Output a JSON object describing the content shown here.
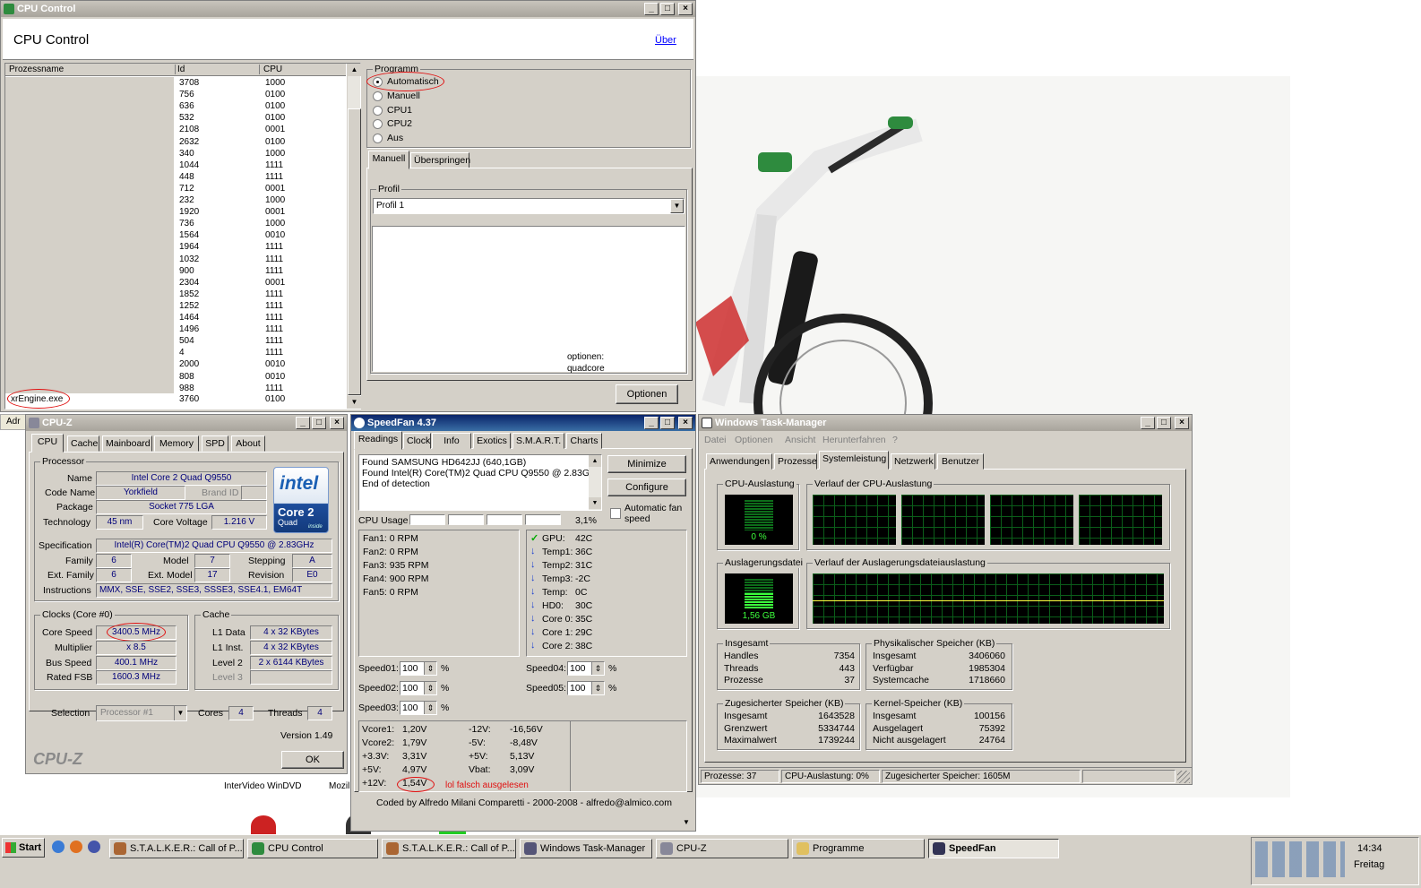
{
  "cpu_control": {
    "title": "CPU Control",
    "heading": "CPU Control",
    "about_link": "Über",
    "columns": [
      "Prozessname",
      "Id",
      "CPU"
    ],
    "rows": [
      {
        "id": "3708",
        "cpu": "1000"
      },
      {
        "id": "756",
        "cpu": "0100"
      },
      {
        "id": "636",
        "cpu": "0100"
      },
      {
        "id": "532",
        "cpu": "0100"
      },
      {
        "id": "2108",
        "cpu": "0001"
      },
      {
        "id": "2632",
        "cpu": "0100"
      },
      {
        "id": "340",
        "cpu": "1000"
      },
      {
        "id": "1044",
        "cpu": "1111"
      },
      {
        "id": "448",
        "cpu": "1111"
      },
      {
        "id": "712",
        "cpu": "0001"
      },
      {
        "id": "232",
        "cpu": "1000"
      },
      {
        "id": "1920",
        "cpu": "0001"
      },
      {
        "id": "736",
        "cpu": "1000"
      },
      {
        "id": "1564",
        "cpu": "0010"
      },
      {
        "id": "1964",
        "cpu": "1111"
      },
      {
        "id": "1032",
        "cpu": "1111"
      },
      {
        "id": "900",
        "cpu": "1111"
      },
      {
        "id": "2304",
        "cpu": "0001"
      },
      {
        "id": "1852",
        "cpu": "1111"
      },
      {
        "id": "1252",
        "cpu": "1111"
      },
      {
        "id": "1464",
        "cpu": "1111"
      },
      {
        "id": "1496",
        "cpu": "1111"
      },
      {
        "id": "504",
        "cpu": "1111"
      },
      {
        "id": "4",
        "cpu": "1111"
      },
      {
        "id": "2000",
        "cpu": "0010"
      },
      {
        "id": "808",
        "cpu": "0010"
      },
      {
        "id": "988",
        "cpu": "1111"
      }
    ],
    "selected_row": {
      "name": "xrEngine.exe",
      "id": "3760",
      "cpu": "0100"
    },
    "program_group": "Programm",
    "program_options": [
      "Automatisch",
      "Manuell",
      "CPU1",
      "CPU2",
      "Aus"
    ],
    "program_selected": "Automatisch",
    "tabs": [
      "Manuell",
      "Überspringen"
    ],
    "profile_group": "Profil",
    "profile_value": "Profil 1",
    "options_note_1": "optionen:",
    "options_note_2": "quadcore",
    "options_button": "Optionen"
  },
  "cpuz": {
    "title": "CPU-Z",
    "tabs": [
      "CPU",
      "Cache",
      "Mainboard",
      "Memory",
      "SPD",
      "About"
    ],
    "processor_group": "Processor",
    "name_label": "Name",
    "name": "Intel Core 2 Quad Q9550",
    "codename_label": "Code Name",
    "codename": "Yorkfield",
    "brandid_label": "Brand ID",
    "package_label": "Package",
    "package": "Socket 775 LGA",
    "technology_label": "Technology",
    "technology": "45 nm",
    "voltage_label": "Core Voltage",
    "voltage": "1.216 V",
    "spec_label": "Specification",
    "spec": "Intel(R) Core(TM)2 Quad CPU   Q9550  @ 2.83GHz",
    "family_label": "Family",
    "family": "6",
    "model_label": "Model",
    "model": "7",
    "stepping_label": "Stepping",
    "stepping": "A",
    "extfamily_label": "Ext. Family",
    "extfamily": "6",
    "extmodel_label": "Ext. Model",
    "extmodel": "17",
    "revision_label": "Revision",
    "revision": "E0",
    "instructions_label": "Instructions",
    "instructions": "MMX, SSE, SSE2, SSE3, SSSE3, SSE4.1, EM64T",
    "clocks_group": "Clocks (Core #0)",
    "corespeed_label": "Core Speed",
    "corespeed": "3400.5 MHz",
    "multiplier_label": "Multiplier",
    "multiplier": "x 8.5",
    "busspeed_label": "Bus Speed",
    "busspeed": "400.1 MHz",
    "ratedfsb_label": "Rated FSB",
    "ratedfsb": "1600.3 MHz",
    "cache_group": "Cache",
    "l1d_label": "L1 Data",
    "l1d": "4 x 32 KBytes",
    "l1i_label": "L1 Inst.",
    "l1i": "4 x 32 KBytes",
    "l2_label": "Level 2",
    "l2": "2 x 6144 KBytes",
    "l3_label": "Level 3",
    "selection_label": "Selection",
    "selection": "Processor #1",
    "cores_label": "Cores",
    "cores": "4",
    "threads_label": "Threads",
    "threads": "4",
    "version": "Version 1.49",
    "brand_footer": "CPU-Z",
    "ok_button": "OK",
    "intel_logo": "intel",
    "intel_product": "Core 2",
    "intel_quad": "Quad",
    "intel_inside": "inside"
  },
  "speedfan": {
    "title": "SpeedFan 4.37",
    "tabs": [
      "Readings",
      "Clock",
      "Info",
      "Exotics",
      "S.M.A.R.T.",
      "Charts"
    ],
    "log": [
      "Found SAMSUNG HD642JJ (640,1GB)",
      "Found Intel(R) Core(TM)2 Quad CPU Q9550 @ 2.83GHz",
      "End of detection"
    ],
    "minimize_button": "Minimize",
    "configure_button": "Configure",
    "auto_fan_label": "Automatic fan speed",
    "cpu_usage_label": "CPU Usage",
    "cpu_usage_value": "3,1%",
    "fans": [
      "Fan1: 0 RPM",
      "Fan2: 0 RPM",
      "Fan3: 935 RPM",
      "Fan4: 900 RPM",
      "Fan5: 0 RPM"
    ],
    "temps": [
      {
        "label": "GPU:",
        "value": "42C",
        "status": "ok"
      },
      {
        "label": "Temp1:",
        "value": "36C",
        "status": "down"
      },
      {
        "label": "Temp2:",
        "value": "31C",
        "status": "down"
      },
      {
        "label": "Temp3:",
        "value": "-2C",
        "status": "down"
      },
      {
        "label": "Temp:",
        "value": "0C",
        "status": "down"
      },
      {
        "label": "HD0:",
        "value": "30C",
        "status": "down"
      },
      {
        "label": "Core 0:",
        "value": "35C",
        "status": "down"
      },
      {
        "label": "Core 1:",
        "value": "29C",
        "status": "down"
      },
      {
        "label": "Core 2:",
        "value": "38C",
        "status": "down"
      }
    ],
    "speeds": [
      {
        "label": "Speed01:",
        "value": "100"
      },
      {
        "label": "Speed02:",
        "value": "100"
      },
      {
        "label": "Speed03:",
        "value": "100"
      },
      {
        "label": "Speed04:",
        "value": "100"
      },
      {
        "label": "Speed05:",
        "value": "100"
      }
    ],
    "percent": "%",
    "volts_left": [
      {
        "label": "Vcore1:",
        "value": "1,20V"
      },
      {
        "label": "Vcore2:",
        "value": "1,79V"
      },
      {
        "label": "+3.3V:",
        "value": "3,31V"
      },
      {
        "label": "+5V:",
        "value": "4,97V"
      },
      {
        "label": "+12V:",
        "value": "1,54V"
      }
    ],
    "volts_right": [
      {
        "label": "-12V:",
        "value": "-16,56V"
      },
      {
        "label": "-5V:",
        "value": "-8,48V"
      },
      {
        "label": "+5V:",
        "value": "5,13V"
      },
      {
        "label": "Vbat:",
        "value": "3,09V"
      }
    ],
    "annotation": "lol falsch ausgelesen",
    "footer": "Coded by Alfredo Milani Comparetti - 2000-2008 - alfredo@almico.com"
  },
  "taskmgr": {
    "title": "Windows Task-Manager",
    "menu": [
      "Datei",
      "Optionen",
      "Ansicht",
      "Herunterfahren",
      "?"
    ],
    "tabs": [
      "Anwendungen",
      "Prozesse",
      "Systemleistung",
      "Netzwerk",
      "Benutzer"
    ],
    "cpu_usage_group": "CPU-Auslastung",
    "cpu_usage_value": "0 %",
    "cpu_history_group": "Verlauf der CPU-Auslastung",
    "pagefile_group": "Auslagerungsdatei",
    "pagefile_value": "1,56 GB",
    "pagefile_history_group": "Verlauf der Auslagerungsdateiauslastung",
    "totals_group": "Insgesamt",
    "totals": [
      {
        "label": "Handles",
        "value": "7354"
      },
      {
        "label": "Threads",
        "value": "443"
      },
      {
        "label": "Prozesse",
        "value": "37"
      }
    ],
    "physical_group": "Physikalischer Speicher (KB)",
    "physical": [
      {
        "label": "Insgesamt",
        "value": "3406060"
      },
      {
        "label": "Verfügbar",
        "value": "1985304"
      },
      {
        "label": "Systemcache",
        "value": "1718660"
      }
    ],
    "commit_group": "Zugesicherter Speicher (KB)",
    "commit": [
      {
        "label": "Insgesamt",
        "value": "1643528"
      },
      {
        "label": "Grenzwert",
        "value": "5334744"
      },
      {
        "label": "Maximalwert",
        "value": "1739244"
      }
    ],
    "kernel_group": "Kernel-Speicher (KB)",
    "kernel": [
      {
        "label": "Insgesamt",
        "value": "100156"
      },
      {
        "label": "Ausgelagert",
        "value": "75392"
      },
      {
        "label": "Nicht ausgelagert",
        "value": "24764"
      }
    ],
    "status": [
      "Prozesse: 37",
      "CPU-Auslastung: 0%",
      "Zugesicherter Speicher: 1605M"
    ]
  },
  "desktop": {
    "addr_fragment": "Adr",
    "icon1_label": "InterVideo WinDVD",
    "icon2_label": "Mozil"
  },
  "taskbar": {
    "start": "Start",
    "items": [
      "S.T.A.L.K.E.R.: Call of P...",
      "CPU Control",
      "S.T.A.L.K.E.R.: Call of P...",
      "Windows Task-Manager",
      "CPU-Z",
      "Programme",
      "SpeedFan"
    ],
    "active": "SpeedFan",
    "clock": "14:34",
    "day": "Freitag"
  },
  "colors": {
    "accent": "#0a246a",
    "graph_green": "#3cff3c",
    "annotation_red": "#e01010",
    "cpuz_value": "#00007a"
  }
}
